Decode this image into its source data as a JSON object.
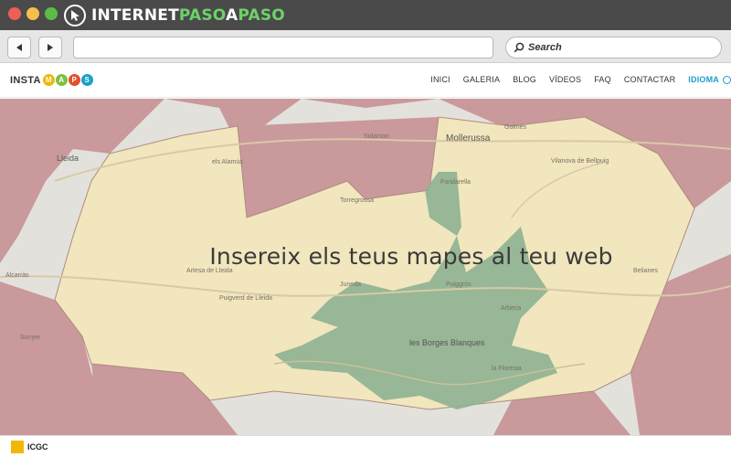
{
  "browser": {
    "brand": {
      "part1": "INTERNET",
      "part2": "PASO",
      "part3": "A",
      "part4": "PASO"
    },
    "search_placeholder": "Search"
  },
  "site": {
    "logo": {
      "text": "INSTA",
      "letters": [
        "M",
        "A",
        "P",
        "S"
      ],
      "letter_colors": [
        "#f2b705",
        "#7fbf3f",
        "#e0522b",
        "#1aa0cc"
      ]
    },
    "nav": [
      "INICI",
      "GALERIA",
      "BLOG",
      "VÍDEOS",
      "FAQ",
      "CONTACTAR"
    ],
    "language_label": "IDIOMA"
  },
  "hero": {
    "headline": "Insereix els teus mapes al teu web"
  },
  "map_labels": {
    "mollerussa": "Mollerussa",
    "borges": "les Borges Blanques",
    "lleida": "Lleida",
    "bellpuig": "Vilanova de Bellpuig",
    "torregrossa": "Torregrossa",
    "artesa": "Artesa de Lleida",
    "puigverd": "Puigverd de Lleida",
    "juneda": "Juneda",
    "puiggros": "Puiggròs",
    "arbeca": "Arbeca",
    "floresta": "la Floresta",
    "sunyer": "Sunyer",
    "alcarras": "Alcarràs",
    "belianes": "Belianes",
    "golmes": "Golmés",
    "sidamon": "Sidamon",
    "albages": "els Alamús",
    "fondarella": "Fondarella"
  },
  "footer": {
    "attribution": "ICGC"
  },
  "colors": {
    "region_yellow": "#f1e6bd",
    "region_red": "#c9999b",
    "region_green": "#8fb392",
    "map_bg": "#e3e1dc"
  }
}
